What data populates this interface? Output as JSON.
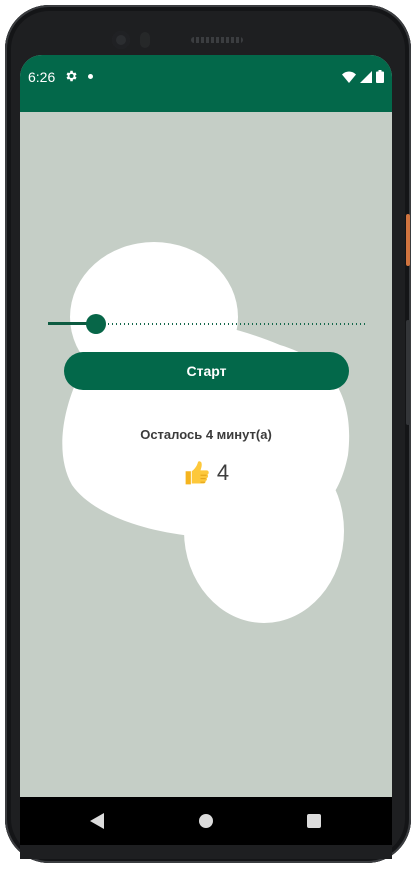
{
  "status_bar": {
    "time": "6:26",
    "icons": [
      "gear-icon",
      "notification-dot-icon",
      "wifi-icon",
      "signal-icon",
      "battery-icon"
    ]
  },
  "main": {
    "slider": {
      "value_fraction": 0.1
    },
    "start_label": "Старт",
    "remaining_text": "Осталось 4 минут(а)",
    "count_icon": "thumbs-up-icon",
    "count_value": "4"
  },
  "nav_bar": {
    "icons": [
      "back-icon",
      "home-icon",
      "recents-icon"
    ]
  },
  "colors": {
    "primary": "#03684a",
    "background": "#c5cec6",
    "blob": "#ffffff"
  }
}
